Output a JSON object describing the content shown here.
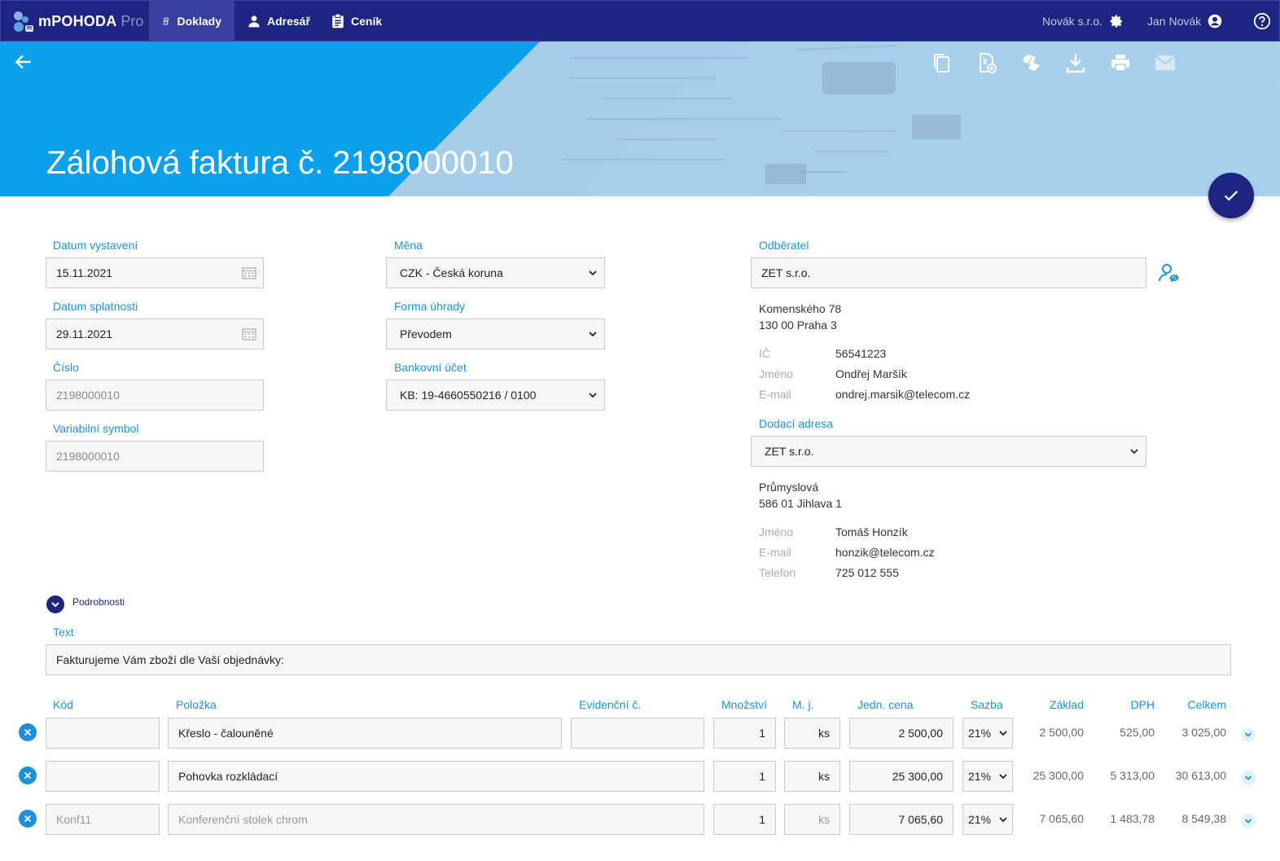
{
  "nav": {
    "brand_name": "mPOHODA",
    "brand_suffix": "Pro",
    "tabs": [
      {
        "label": "Doklady",
        "icon": "documents-icon"
      },
      {
        "label": "Adresář",
        "icon": "person-icon"
      },
      {
        "label": "Ceník",
        "icon": "clipboard-icon"
      }
    ],
    "company": "Novák s.r.o.",
    "user": "Jan Novák"
  },
  "header": {
    "title": "Zálohová faktura č. 2198000010",
    "toolbar_icons": [
      "copy-icon",
      "new-document-icon",
      "convert-icon",
      "download-icon",
      "print-icon",
      "email-icon"
    ]
  },
  "form": {
    "datum_vystaveni": {
      "label": "Datum vystavení",
      "value": "15.11.2021"
    },
    "datum_splatnosti": {
      "label": "Datum splatnosti",
      "value": "29.11.2021"
    },
    "cislo": {
      "label": "Číslo",
      "value": "2198000010"
    },
    "variabilni_symbol": {
      "label": "Variabilní symbol",
      "value": "2198000010"
    },
    "mena": {
      "label": "Měna",
      "value": "CZK - Česká koruna"
    },
    "forma_uhrady": {
      "label": "Forma úhrady",
      "value": "Převodem"
    },
    "bankovni_ucet": {
      "label": "Bankovní účet",
      "value": "KB: 19-4660550216 / 0100"
    }
  },
  "odberatel": {
    "label": "Odběratel",
    "name": "ZET s.r.o.",
    "street": "Komenského 78",
    "city": "130 00 Praha 3",
    "ic_label": "IČ",
    "ic": "56541223",
    "jmeno_label": "Jméno",
    "jmeno": "Ondřej Maršík",
    "email_label": "E-mail",
    "email": "ondrej.marsik@telecom.cz"
  },
  "dodaci": {
    "label": "Dodací adresa",
    "value": "ZET s.r.o.",
    "street": "Průmyslová",
    "city": "586 01 Jihlava 1",
    "jmeno_label": "Jméno",
    "jmeno": "Tomáš Honzík",
    "email_label": "E-mail",
    "email": "honzik@telecom.cz",
    "telefon_label": "Telefon",
    "telefon": "725 012 555"
  },
  "details": {
    "label": "Podrobnosti"
  },
  "text": {
    "label": "Text",
    "value": "Fakturujeme Vám zboží dle Vaší objednávky:"
  },
  "table": {
    "headers": {
      "kod": "Kód",
      "polozka": "Položka",
      "evidencni": "Evidenční č.",
      "mnozstvi": "Množství",
      "mj": "M. j.",
      "jedn_cena": "Jedn. cena",
      "sazba": "Sazba",
      "zaklad": "Základ",
      "dph": "DPH",
      "celkem": "Celkem"
    },
    "rows": [
      {
        "kod": "",
        "polozka": "Křeslo - čalouněné",
        "evidencni": "",
        "mnozstvi": "1",
        "mj": "ks",
        "cena": "2 500,00",
        "sazba": "21%",
        "zaklad": "2 500,00",
        "dph": "525,00",
        "celkem": "3 025,00"
      },
      {
        "kod": "",
        "polozka": "Pohovka rozkládací",
        "mnozstvi": "1",
        "mj": "ks",
        "cena": "25 300,00",
        "sazba": "21%",
        "zaklad": "25 300,00",
        "dph": "5 313,00",
        "celkem": "30 613,00"
      },
      {
        "kod": "Konf11",
        "polozka": "Konferenční stolek chrom",
        "mnozstvi": "1",
        "mj": "ks",
        "cena": "7 065,60",
        "sazba": "21%",
        "zaklad": "7 065,60",
        "dph": "1 483,78",
        "celkem": "8 549,38"
      }
    ]
  },
  "colors": {
    "navy": "#1d2580",
    "accent": "#1e90d8",
    "banner": "#0aa0ec"
  }
}
